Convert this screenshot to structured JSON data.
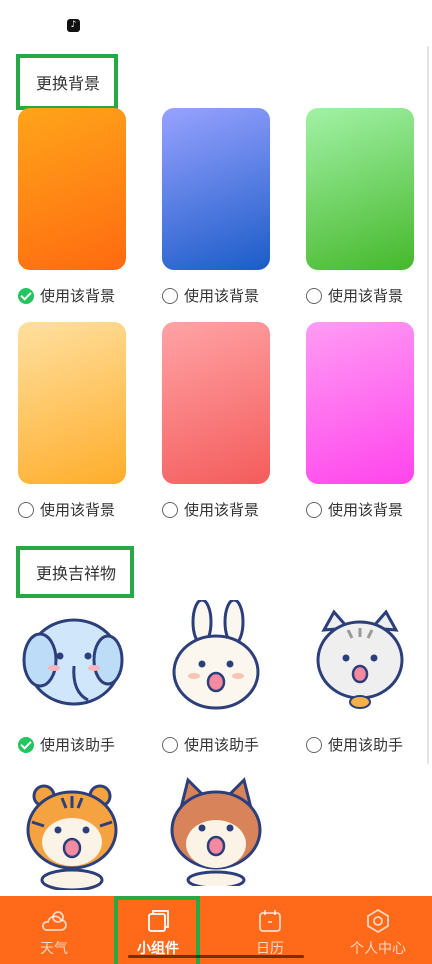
{
  "status_bar": {
    "app_icon": "tiktok-icon"
  },
  "background_section": {
    "title": "更换背景",
    "options": [
      {
        "label": "使用该背景",
        "selected": true,
        "gradient": [
          "#ffa51a",
          "#ff6a10"
        ]
      },
      {
        "label": "使用该背景",
        "selected": false,
        "gradient": [
          "#98a2ff",
          "#1b5cc8"
        ]
      },
      {
        "label": "使用该背景",
        "selected": false,
        "gradient": [
          "#a2f2a6",
          "#46b82c"
        ]
      },
      {
        "label": "使用该背景",
        "selected": false,
        "gradient": [
          "#ffe0a0",
          "#ffad2a"
        ]
      },
      {
        "label": "使用该背景",
        "selected": false,
        "gradient": [
          "#ffa3a5",
          "#f45c5c"
        ]
      },
      {
        "label": "使用该背景",
        "selected": false,
        "gradient": [
          "#ff9cf4",
          "#ff44ec"
        ]
      }
    ]
  },
  "mascot_section": {
    "title": "更换吉祥物",
    "options": [
      {
        "label": "使用该助手",
        "selected": true,
        "mascot": "elephant"
      },
      {
        "label": "使用该助手",
        "selected": false,
        "mascot": "rabbit"
      },
      {
        "label": "使用该助手",
        "selected": false,
        "mascot": "cat"
      },
      {
        "label": "",
        "selected": false,
        "mascot": "tiger"
      },
      {
        "label": "",
        "selected": false,
        "mascot": "fox"
      }
    ]
  },
  "tabbar": {
    "items": [
      {
        "label": "天气",
        "icon": "weather-icon",
        "active": false
      },
      {
        "label": "小组件",
        "icon": "widget-icon",
        "active": true
      },
      {
        "label": "日历",
        "icon": "calendar-icon",
        "active": false
      },
      {
        "label": "个人中心",
        "icon": "profile-icon",
        "active": false
      }
    ]
  },
  "colors": {
    "accent": "#ff6a1a",
    "highlight_box": "#27a844",
    "check": "#22c55e"
  }
}
